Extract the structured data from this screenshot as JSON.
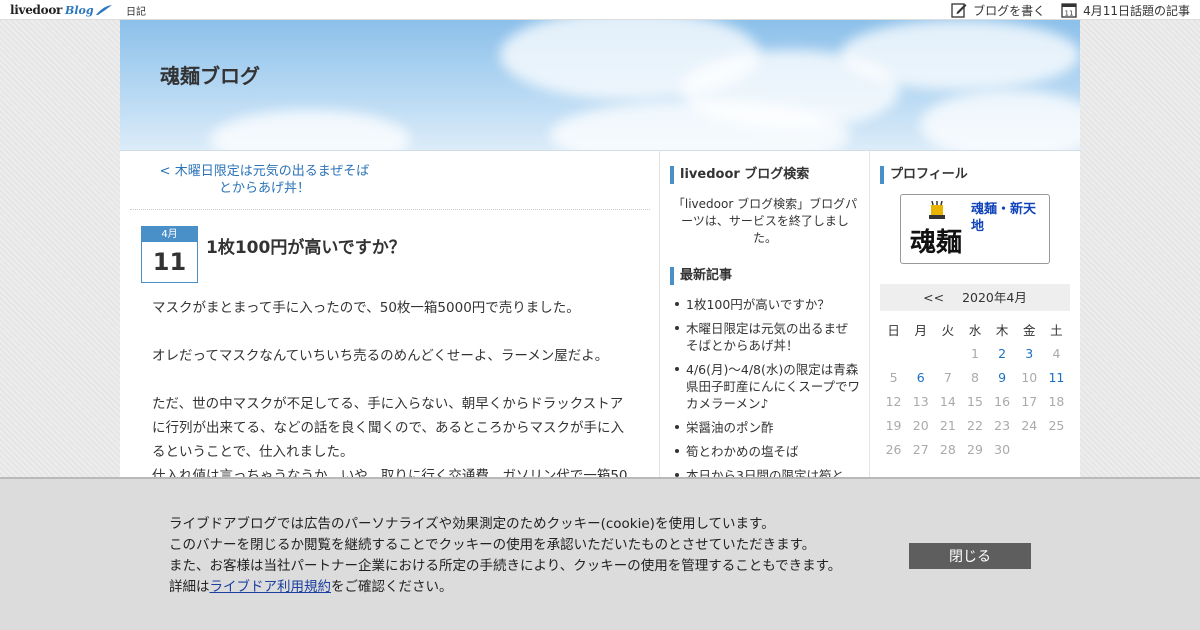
{
  "topbar": {
    "logo_text": "livedoor",
    "logo_sub": "Blog",
    "diary_label": "日記",
    "write_blog": "ブログを書く",
    "topic_articles": "4月11日話題の記事",
    "calendar_icon_day": "11"
  },
  "header": {
    "site_title": "魂麺ブログ"
  },
  "main": {
    "prev_link": "< 木曜日限定は元気の出るまぜそば とからあげ丼！",
    "date_month": "4月",
    "date_day": "11",
    "post_title": "1枚100円が高いですか？",
    "body": [
      "マスクがまとまって手に入ったので、50枚一箱5000円で売りました。",
      "オレだってマスクなんていちいち売るのめんどくせーよ、ラーメン屋だよ。",
      "ただ、世の中マスクが不足してる、手に入らない、朝早くからドラックストアに行列が出来てる、などの話を良く聞くので、あるところからマスクが手に入るということで、仕入れました。",
      "仕入れ値は言っちゃうなうか、いや、取りに行く交通費、ガソリン代で一箱50"
    ]
  },
  "sidebar1": {
    "search_heading": "livedoor ブログ検索",
    "search_text": "「livedoor ブログ検索」ブログパーツは、サービスを終了しました。",
    "recent_heading": "最新記事",
    "recent_items": [
      "1枚100円が高いですか？",
      "木曜日限定は元気の出るまぜそばとからあげ丼！",
      "4/6(月)〜4/8(水)の限定は青森県田子町産にんにくスープでワカメラーメン♪",
      "栄醤油のポン酢",
      "筍とわかめの塩そば",
      "本日から3日間の限定は筍と"
    ]
  },
  "sidebar2": {
    "profile_heading": "プロフィール",
    "profile_name": "魂麺・新天地",
    "profile_logo_text": "魂麺",
    "calendar": {
      "prev": "<<",
      "month_label": "2020年4月",
      "weekdays": [
        "日",
        "月",
        "火",
        "水",
        "木",
        "金",
        "土"
      ],
      "weeks": [
        [
          "",
          "",
          "",
          "1",
          "2",
          "3",
          "4"
        ],
        [
          "5",
          "6",
          "7",
          "8",
          "9",
          "10",
          "11"
        ],
        [
          "12",
          "13",
          "14",
          "15",
          "16",
          "17",
          "18"
        ],
        [
          "19",
          "20",
          "21",
          "22",
          "23",
          "24",
          "25"
        ],
        [
          "26",
          "27",
          "28",
          "29",
          "30",
          "",
          ""
        ]
      ],
      "linked_days": [
        "2",
        "3",
        "6",
        "9",
        "11"
      ],
      "link_color": "#1d6fc2"
    }
  },
  "cookie": {
    "line1": "ライブドアブログでは広告のパーソナライズや効果測定のためクッキー(cookie)を使用しています。",
    "line2": "このバナーを閉じるか閲覧を継続することでクッキーの使用を承認いただいたものとさせていただきます。",
    "line3": "また、お客様は当社パートナー企業における所定の手続きにより、クッキーの使用を管理することもできます。",
    "line4_prefix": "詳細は",
    "line4_link": "ライブドア利用規約",
    "line4_suffix": "をご確認ください。",
    "close_label": "閉じる"
  },
  "colors": {
    "accent": "#4a90c8",
    "link": "#2b73b8",
    "banner_bg": "#dcdcdc",
    "close_button": "#5e5e5e"
  }
}
